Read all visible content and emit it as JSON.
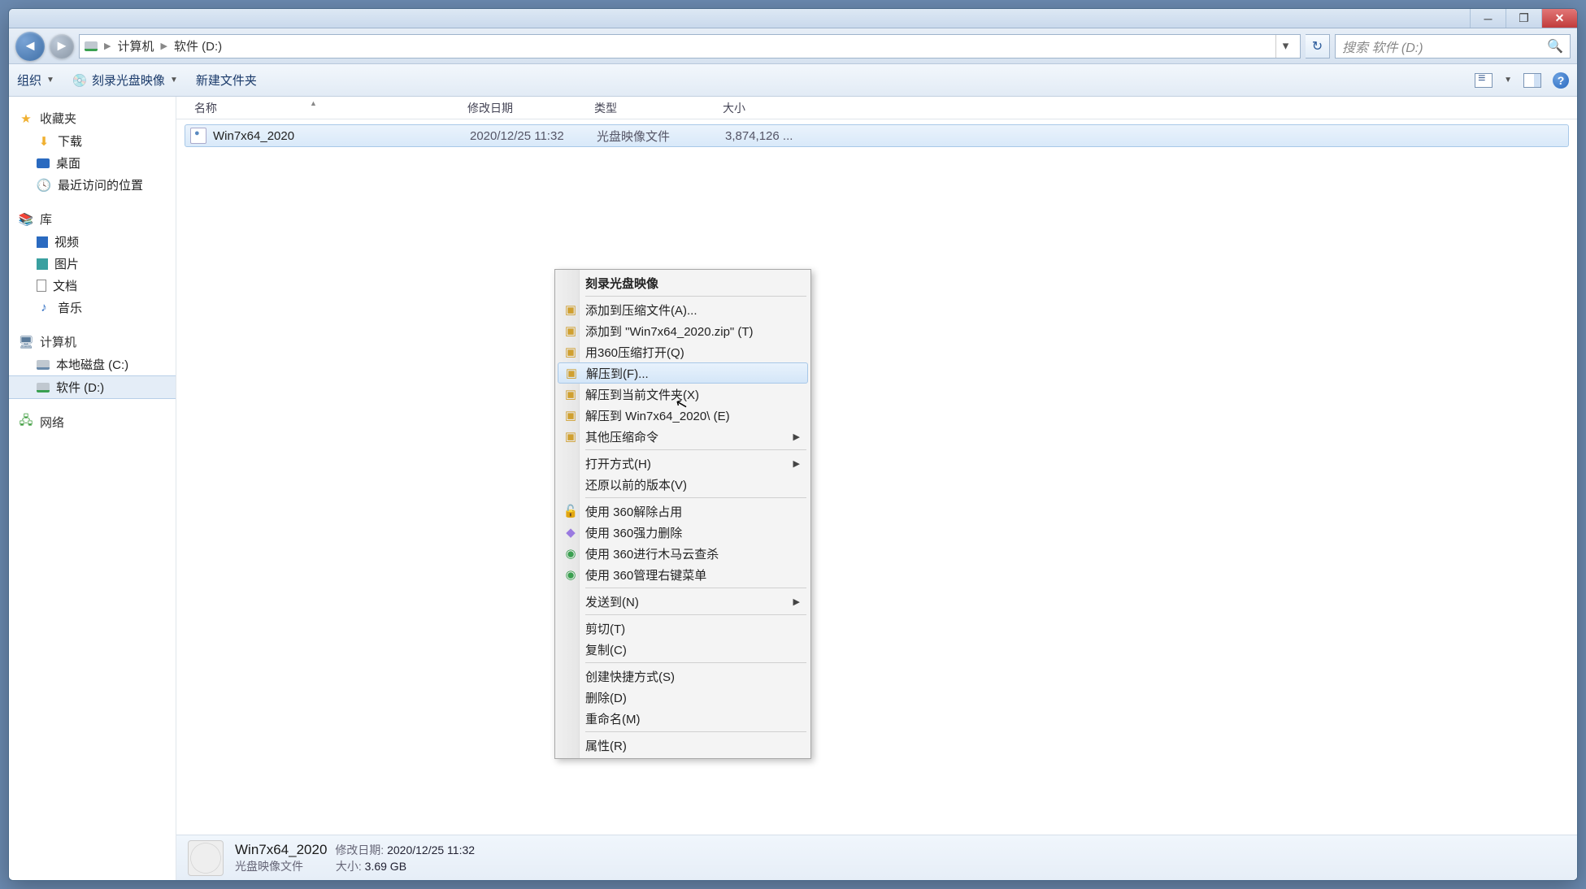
{
  "breadcrumb": {
    "seg1": "计算机",
    "seg2": "软件 (D:)"
  },
  "search": {
    "placeholder": "搜索 软件 (D:)"
  },
  "toolbar": {
    "organize": "组织",
    "burn": "刻录光盘映像",
    "newfolder": "新建文件夹"
  },
  "sidebar": {
    "favorites": "收藏夹",
    "downloads": "下载",
    "desktop": "桌面",
    "recent": "最近访问的位置",
    "libraries": "库",
    "videos": "视频",
    "pictures": "图片",
    "documents": "文档",
    "music": "音乐",
    "computer": "计算机",
    "cdrive": "本地磁盘 (C:)",
    "ddrive": "软件 (D:)",
    "network": "网络"
  },
  "columns": {
    "name": "名称",
    "date": "修改日期",
    "type": "类型",
    "size": "大小"
  },
  "file": {
    "name": "Win7x64_2020",
    "date": "2020/12/25 11:32",
    "type": "光盘映像文件",
    "size": "3,874,126 ..."
  },
  "details": {
    "title": "Win7x64_2020",
    "subtitle": "光盘映像文件",
    "datelabel": "修改日期:",
    "dateval": "2020/12/25 11:32",
    "sizelabel": "大小:",
    "sizeval": "3.69 GB"
  },
  "ctx": {
    "burn": "刻录光盘映像",
    "addarchive": "添加到压缩文件(A)...",
    "addzip": "添加到 \"Win7x64_2020.zip\" (T)",
    "openwith360": "用360压缩打开(Q)",
    "extractto": "解压到(F)...",
    "extracthere": "解压到当前文件夹(X)",
    "extractfolder": "解压到 Win7x64_2020\\ (E)",
    "othercompress": "其他压缩命令",
    "openwith": "打开方式(H)",
    "restoreprev": "还原以前的版本(V)",
    "unlock360": "使用 360解除占用",
    "forcedel360": "使用 360强力删除",
    "trojscan360": "使用 360进行木马云查杀",
    "ctxmgr360": "使用 360管理右键菜单",
    "sendto": "发送到(N)",
    "cut": "剪切(T)",
    "copy": "复制(C)",
    "shortcut": "创建快捷方式(S)",
    "delete": "删除(D)",
    "rename": "重命名(M)",
    "properties": "属性(R)"
  }
}
